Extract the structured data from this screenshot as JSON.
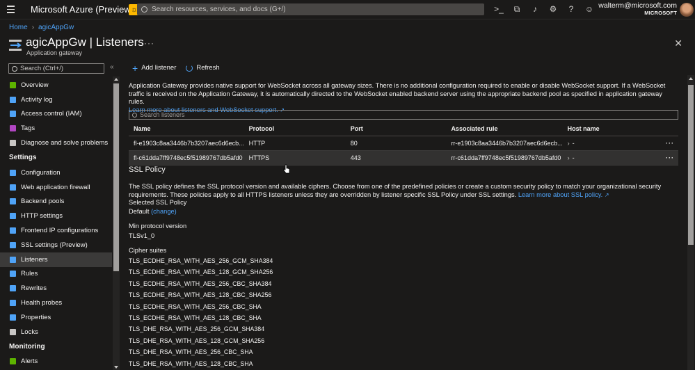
{
  "topbar": {
    "brand": "Microsoft Azure (Preview)",
    "search_placeholder": "Search resources, services, and docs (G+/)",
    "account_email": "walterm@microsoft.com",
    "account_tenant": "MICROSOFT",
    "icons": [
      "cloud-shell-icon",
      "directory-filter-icon",
      "bell-icon",
      "gear-icon",
      "help-icon",
      "feedback-icon"
    ]
  },
  "breadcrumb": {
    "home": "Home",
    "current": "agicAppGw"
  },
  "header": {
    "title": "agicAppGw | Listeners",
    "subtitle": "Application gateway",
    "more": "···"
  },
  "nav": {
    "search_placeholder": "Search (Ctrl+/)",
    "top_items": [
      {
        "label": "Overview",
        "color": "#5db300"
      },
      {
        "label": "Activity log",
        "color": "#4fa3f7"
      },
      {
        "label": "Access control (IAM)",
        "color": "#4fa3f7"
      },
      {
        "label": "Tags",
        "color": "#b146c2"
      },
      {
        "label": "Diagnose and solve problems",
        "color": "#c8c6c4"
      }
    ],
    "settings_title": "Settings",
    "settings_items": [
      {
        "label": "Configuration",
        "color": "#4fa3f7"
      },
      {
        "label": "Web application firewall",
        "color": "#4fa3f7"
      },
      {
        "label": "Backend pools",
        "color": "#4fa3f7"
      },
      {
        "label": "HTTP settings",
        "color": "#4fa3f7"
      },
      {
        "label": "Frontend IP configurations",
        "color": "#4fa3f7"
      },
      {
        "label": "SSL settings (Preview)",
        "color": "#4fa3f7"
      },
      {
        "label": "Listeners",
        "color": "#4fa3f7"
      },
      {
        "label": "Rules",
        "color": "#4fa3f7"
      },
      {
        "label": "Rewrites",
        "color": "#4fa3f7"
      },
      {
        "label": "Health probes",
        "color": "#4fa3f7"
      },
      {
        "label": "Properties",
        "color": "#4fa3f7"
      },
      {
        "label": "Locks",
        "color": "#c8c6c4"
      }
    ],
    "monitoring_title": "Monitoring",
    "monitoring_items": [
      {
        "label": "Alerts",
        "color": "#5db300"
      }
    ]
  },
  "toolbar": {
    "add_label": "Add listener",
    "refresh_label": "Refresh"
  },
  "info": {
    "text": "Application Gateway provides native support for WebSocket across all gateway sizes. There is no additional configuration required to enable or disable WebSocket support. If a WebSocket traffic is received on the Application Gateway, it is automatically directed to the WebSocket enabled backend server using the appropriate backend pool as specified in application gateway rules.",
    "link": "Learn more about listeners and WebSocket support."
  },
  "list": {
    "search_placeholder": "Search listeners",
    "columns": [
      "Name",
      "Protocol",
      "Port",
      "Associated rule",
      "Host name"
    ],
    "rows": [
      {
        "name": "fl-e1903c8aa3446b7b3207aec6d6ecb...",
        "protocol": "HTTP",
        "port": "80",
        "rule": "rr-e1903c8aa3446b7b3207aec6d6ecb...",
        "host": "-"
      },
      {
        "name": "fl-c61dda7ff9748ec5f51989767db5afd0",
        "protocol": "HTTPS",
        "port": "443",
        "rule": "rr-c61dda7ff9748ec5f51989767db5afd0",
        "host": "-"
      }
    ]
  },
  "ssl": {
    "title": "SSL Policy",
    "description": "The SSL policy defines the SSL protocol version and available ciphers. Choose from one of the predefined policies or create a custom security policy to match your organizational security requirements. These policies apply to all HTTPS listeners unless they are overridden by listener specific SSL Policy under SSL settings.",
    "learn_more": "Learn more about SSL policy.",
    "selected_label": "Selected SSL Policy",
    "selected_value": "Default",
    "change_link": "(change)",
    "min_protocol_label": "Min protocol version",
    "min_protocol_value": "TLSv1_0",
    "cipher_label": "Cipher suites",
    "ciphers": [
      "TLS_ECDHE_RSA_WITH_AES_256_GCM_SHA384",
      "TLS_ECDHE_RSA_WITH_AES_128_GCM_SHA256",
      "TLS_ECDHE_RSA_WITH_AES_256_CBC_SHA384",
      "TLS_ECDHE_RSA_WITH_AES_128_CBC_SHA256",
      "TLS_ECDHE_RSA_WITH_AES_256_CBC_SHA",
      "TLS_ECDHE_RSA_WITH_AES_128_CBC_SHA",
      "TLS_DHE_RSA_WITH_AES_256_GCM_SHA384",
      "TLS_DHE_RSA_WITH_AES_128_GCM_SHA256",
      "TLS_DHE_RSA_WITH_AES_256_CBC_SHA",
      "TLS_DHE_RSA_WITH_AES_128_CBC_SHA"
    ]
  }
}
